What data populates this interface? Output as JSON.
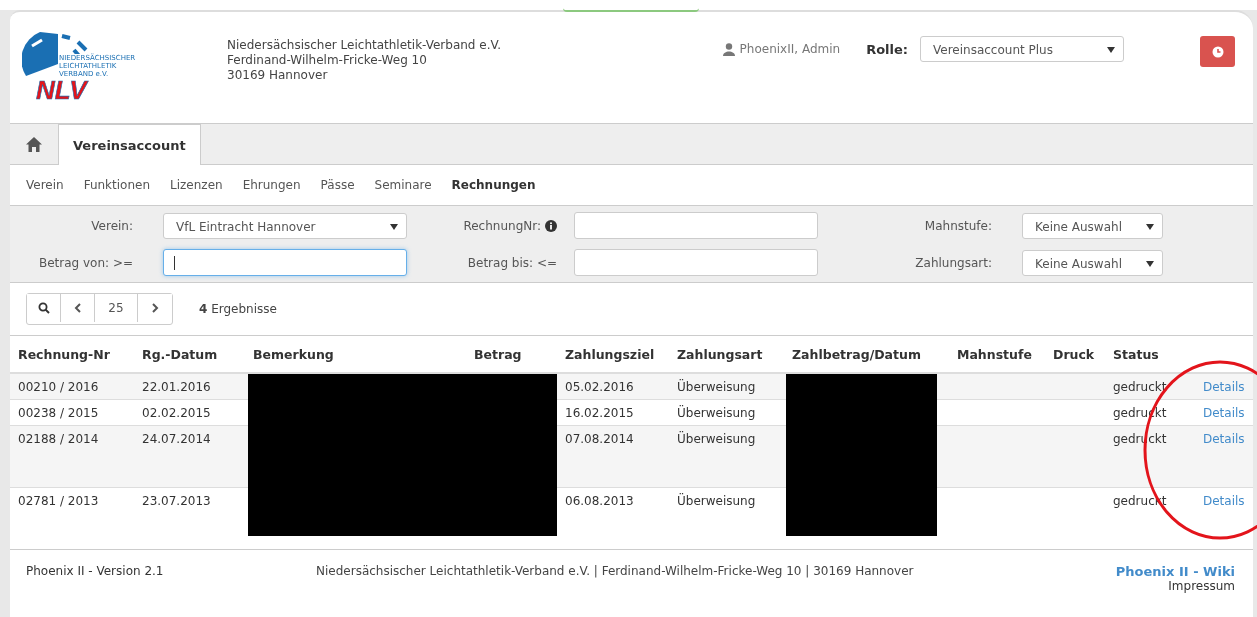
{
  "header": {
    "org_lines": [
      "Niedersächsischer Leichtathletik-Verband e.V.",
      "Ferdinand-Wilhelm-Fricke-Weg 10",
      "30169 Hannover"
    ],
    "logo_text": "NLV",
    "logo_subtext": [
      "NIEDERSÄCHSISCHER",
      "LEICHTATHLETIK",
      "VERBAND e.V."
    ],
    "user": "PhoenixII, Admin",
    "role_label": "Rolle:",
    "role_value": "Vereinsaccount Plus"
  },
  "tabs": [
    {
      "label": "Vereinsaccount",
      "selected": true
    }
  ],
  "subnav": [
    {
      "label": "Verein",
      "selected": false
    },
    {
      "label": "Funktionen",
      "selected": false
    },
    {
      "label": "Lizenzen",
      "selected": false
    },
    {
      "label": "Ehrungen",
      "selected": false
    },
    {
      "label": "Pässe",
      "selected": false
    },
    {
      "label": "Seminare",
      "selected": false
    },
    {
      "label": "Rechnungen",
      "selected": true
    }
  ],
  "filters": {
    "verein_label": "Verein:",
    "verein_value": "VfL Eintracht Hannover",
    "rechnung_label": "RechnungNr:",
    "mahnstufe_label": "Mahnstufe:",
    "mahnstufe_value": "Keine Auswahl",
    "betrag_von_label": "Betrag von: >=",
    "betrag_bis_label": "Betrag bis: <=",
    "zahlungsart_label": "Zahlungsart:",
    "zahlungsart_value": "Keine Auswahl"
  },
  "pager": {
    "page_size": "25",
    "result_count": "4",
    "result_label": "Ergebnisse"
  },
  "table": {
    "columns": [
      "Rechnung-Nr",
      "Rg.-Datum",
      "Bemerkung",
      "Betrag",
      "Zahlungsziel",
      "Zahlungsart",
      "Zahlbetrag/Datum",
      "Mahnstufe",
      "Druck",
      "Status"
    ],
    "rows": [
      {
        "nr": "00210 / 2016",
        "datum": "22.01.2016",
        "ziel": "05.02.2016",
        "art": "Überweisung",
        "status": "gedruckt",
        "link": "Details",
        "tall": false
      },
      {
        "nr": "00238 / 2015",
        "datum": "02.02.2015",
        "ziel": "16.02.2015",
        "art": "Überweisung",
        "status": "gedruckt",
        "link": "Details",
        "tall": false
      },
      {
        "nr": "02188 / 2014",
        "datum": "24.07.2014",
        "ziel": "07.08.2014",
        "art": "Überweisung",
        "status": "gedruckt",
        "link": "Details",
        "tall": true
      },
      {
        "nr": "02781 / 2013",
        "datum": "23.07.2013",
        "ziel": "06.08.2013",
        "art": "Überweisung",
        "status": "gedruckt",
        "link": "Details",
        "tall": true
      }
    ]
  },
  "footer": {
    "version": "Phoenix II - Version 2.1",
    "address": "Niedersächsischer Leichtathletik-Verband e.V. | Ferdinand-Wilhelm-Fricke-Weg 10 | 30169 Hannover",
    "wiki": "Phoenix II - Wiki",
    "impressum": "Impressum"
  }
}
